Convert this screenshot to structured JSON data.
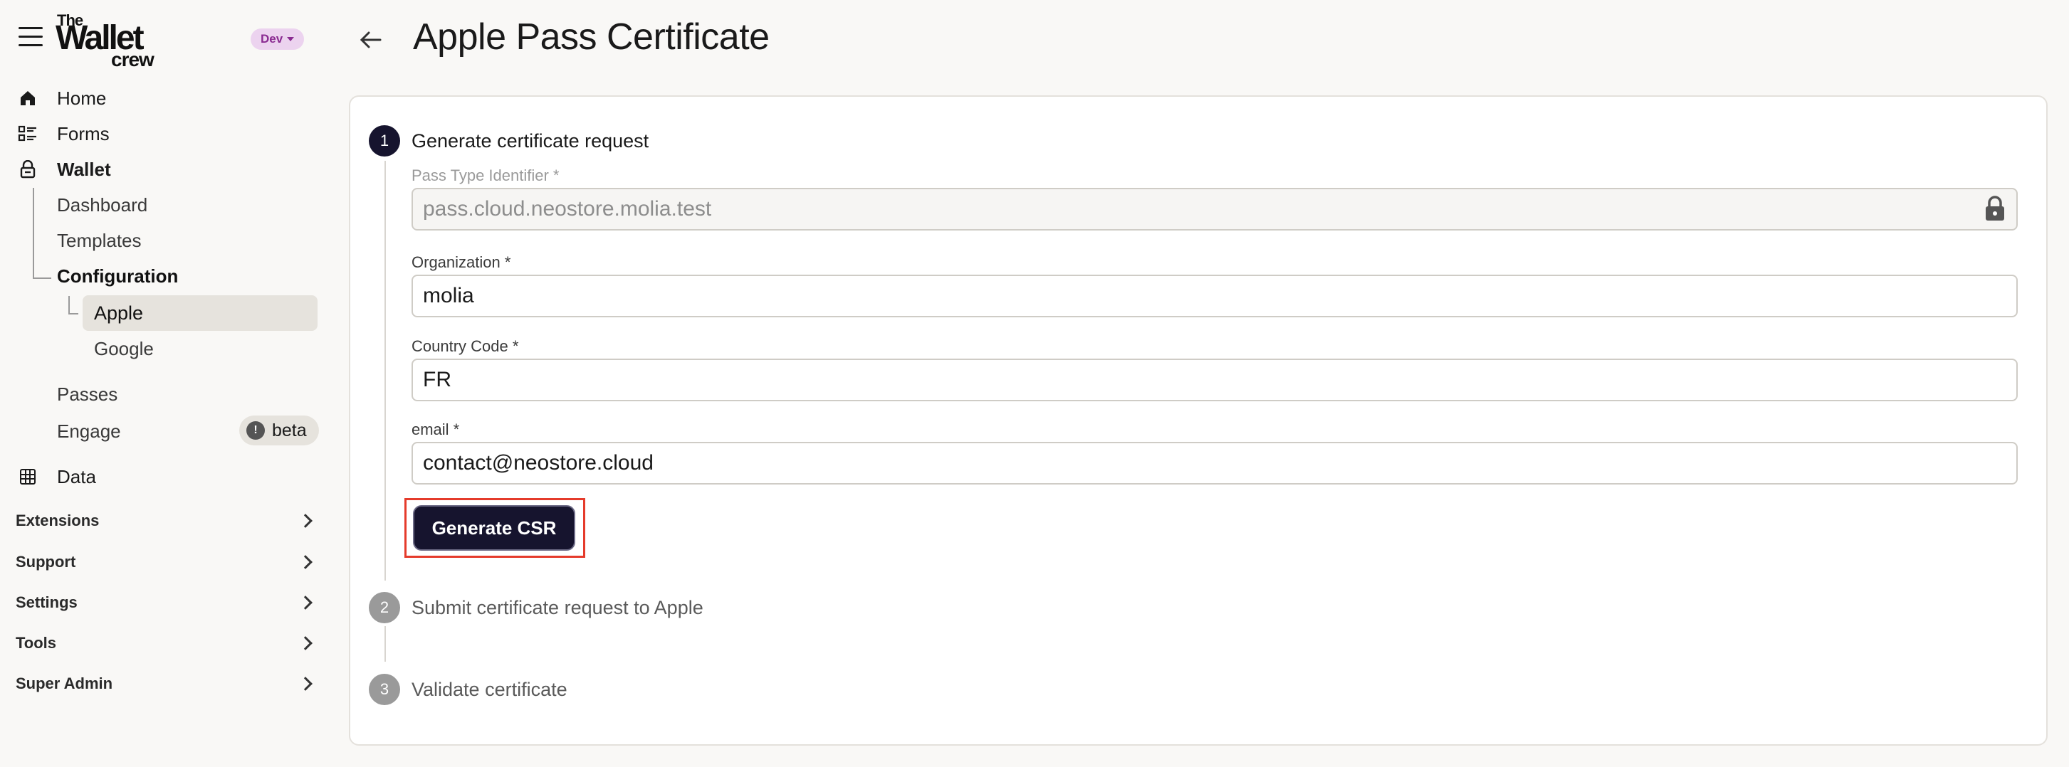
{
  "sidebar": {
    "env_badge": "Dev",
    "logo": {
      "line1": "The",
      "line2": "Wallet",
      "line3": "crew"
    },
    "nav": {
      "home": "Home",
      "forms": "Forms",
      "wallet": "Wallet",
      "dashboard": "Dashboard",
      "templates": "Templates",
      "configuration": "Configuration",
      "apple": "Apple",
      "google": "Google",
      "passes": "Passes",
      "engage": "Engage",
      "engage_badge": "beta",
      "data": "Data"
    },
    "sections": {
      "extensions": "Extensions",
      "support": "Support",
      "settings": "Settings",
      "tools": "Tools",
      "super_admin": "Super Admin"
    }
  },
  "header": {
    "title": "Apple Pass Certificate"
  },
  "steps": [
    {
      "number": "1",
      "title": "Generate certificate request",
      "state": "active"
    },
    {
      "number": "2",
      "title": "Submit certificate request to Apple",
      "state": "inactive"
    },
    {
      "number": "3",
      "title": "Validate certificate",
      "state": "inactive"
    }
  ],
  "form": {
    "pass_type_identifier": {
      "label": "Pass Type Identifier *",
      "value": "pass.cloud.neostore.molia.test",
      "disabled": true
    },
    "organization": {
      "label": "Organization *",
      "value": "molia"
    },
    "country_code": {
      "label": "Country Code *",
      "value": "FR"
    },
    "email": {
      "label": "email *",
      "value": "contact@neostore.cloud"
    },
    "generate_button": "Generate CSR"
  },
  "colors": {
    "primary": "#16142e",
    "highlight": "#e53b2b",
    "env_badge_bg": "#ecd3ef",
    "env_badge_text": "#8a2b91"
  }
}
